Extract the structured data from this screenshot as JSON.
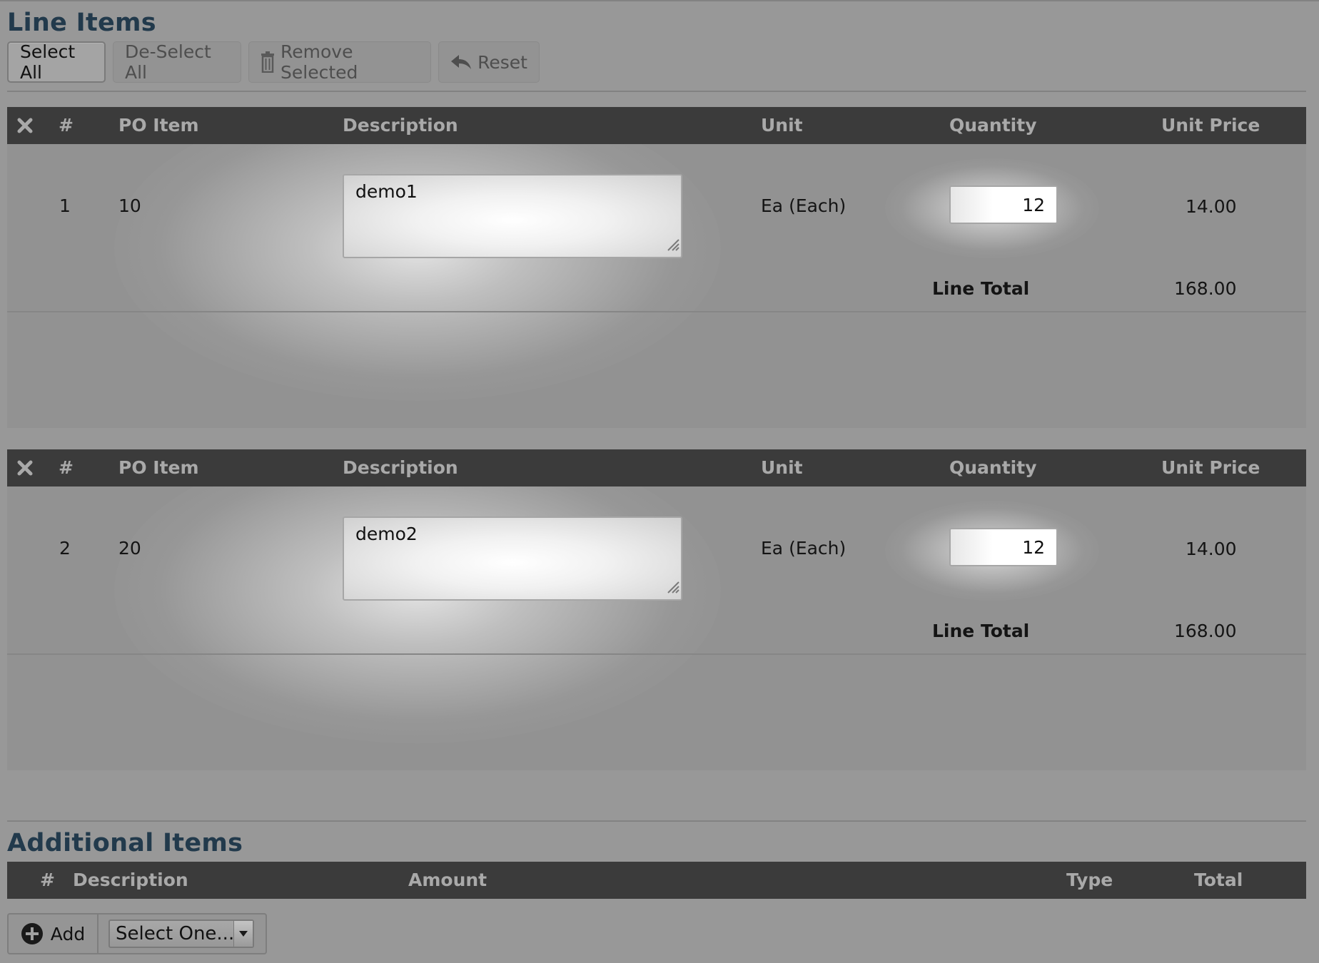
{
  "line_items": {
    "title": "Line Items",
    "toolbar": {
      "select_all": "Select All",
      "deselect_all": "De-Select All",
      "remove_selected": "Remove Selected",
      "reset": "Reset"
    },
    "columns": {
      "num": "#",
      "po_item": "PO Item",
      "description": "Description",
      "unit": "Unit",
      "quantity": "Quantity",
      "unit_price": "Unit Price"
    },
    "rows": [
      {
        "num": "1",
        "po_item": "10",
        "description": "demo1",
        "unit": "Ea (Each)",
        "quantity": "12",
        "unit_price": "14.00",
        "line_total_label": "Line Total",
        "line_total": "168.00"
      },
      {
        "num": "2",
        "po_item": "20",
        "description": "demo2",
        "unit": "Ea (Each)",
        "quantity": "12",
        "unit_price": "14.00",
        "line_total_label": "Line Total",
        "line_total": "168.00"
      }
    ]
  },
  "additional_items": {
    "title": "Additional Items",
    "columns": {
      "num": "#",
      "description": "Description",
      "amount": "Amount",
      "type": "Type",
      "total": "Total"
    },
    "add_button": "Add",
    "select": {
      "value": "Select One..."
    }
  },
  "icons": {
    "remove_column": "close-icon",
    "remove_selected": "trash-icon",
    "reset": "reply-arrow-icon",
    "add": "plus-circle-icon",
    "select_arrow": "chevron-down-icon"
  },
  "colors": {
    "page_bg": "#989898",
    "header_bg": "#3b3b3b",
    "header_text": "#a9a9a9",
    "section_title": "#223a4c"
  }
}
